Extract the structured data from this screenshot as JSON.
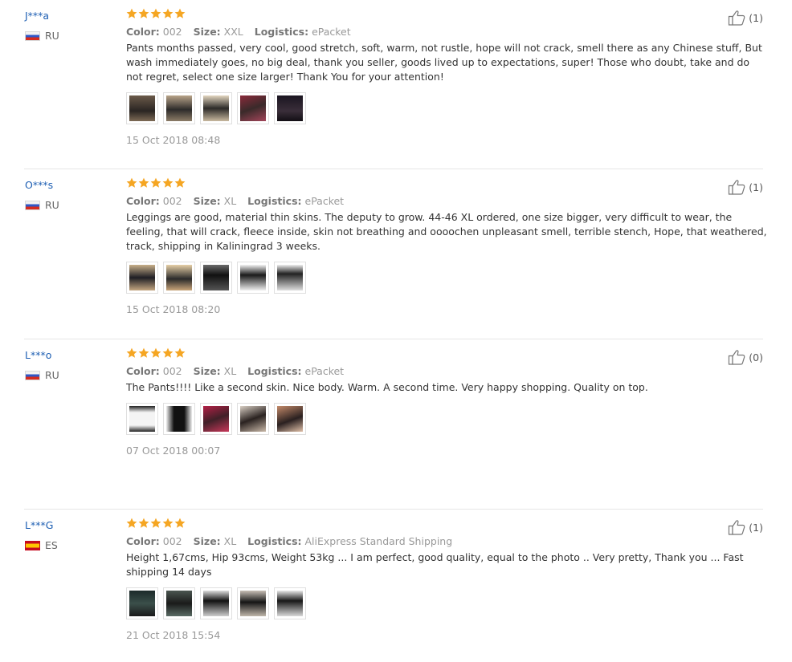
{
  "reviews": [
    {
      "user": "J***a",
      "country": "RU",
      "rating": 5,
      "color_label": "Color:",
      "color": "002",
      "size_label": "Size:",
      "size": "XXL",
      "logistics_label": "Logistics:",
      "logistics": "ePacket",
      "text": "Pants months passed, very cool, good stretch, soft, warm, not rustle, hope will not crack, smell there as any Chinese stuff, But wash immediately goes, no big deal, thank you seller, goods lived up to expectations, super! Those who doubt, take and do not regret, select one size larger! Thank You for your attention!",
      "photo_count": 5,
      "date": "15 Oct 2018 08:48",
      "helpful": "(1)"
    },
    {
      "user": "O***s",
      "country": "RU",
      "rating": 5,
      "color_label": "Color:",
      "color": "002",
      "size_label": "Size:",
      "size": "XL",
      "logistics_label": "Logistics:",
      "logistics": "ePacket",
      "text": "Leggings are good, material thin skins. The deputy to grow. 44-46 XL ordered, one size bigger, very difficult to wear, the feeling, that will crack, fleece inside, skin not breathing and oooochen unpleasant smell, terrible stench, Hope, that weathered, track, shipping in Kaliningrad 3 weeks.",
      "photo_count": 5,
      "date": "15 Oct 2018 08:20",
      "helpful": "(1)"
    },
    {
      "user": "L***o",
      "country": "RU",
      "rating": 5,
      "color_label": "Color:",
      "color": "002",
      "size_label": "Size:",
      "size": "XL",
      "logistics_label": "Logistics:",
      "logistics": "ePacket",
      "text": "The Pants!!!! Like a second skin. Nice body. Warm. A second time. Very happy shopping. Quality on top.",
      "photo_count": 5,
      "date": "07 Oct 2018 00:07",
      "helpful": "(0)"
    },
    {
      "user": "L***G",
      "country": "ES",
      "rating": 5,
      "color_label": "Color:",
      "color": "002",
      "size_label": "Size:",
      "size": "XL",
      "logistics_label": "Logistics:",
      "logistics": "AliExpress Standard Shipping",
      "text": "Height 1,67cms, Hip 93cms, Weight 53kg ... I am perfect, good quality, equal to the photo .. Very pretty, Thank you ... Fast shipping 14 days",
      "photo_count": 5,
      "date": "21 Oct 2018 15:54",
      "helpful": "(1)"
    }
  ],
  "colors": {
    "star": "#f5a623",
    "user_link": "#1e5fb3",
    "meta_value": "#999999",
    "divider": "#e6e6e6"
  },
  "icons": {
    "rating": "star-icon",
    "helpful": "thumbs-up-icon",
    "flag_ru": "flag-russia-icon",
    "flag_es": "flag-spain-icon"
  }
}
